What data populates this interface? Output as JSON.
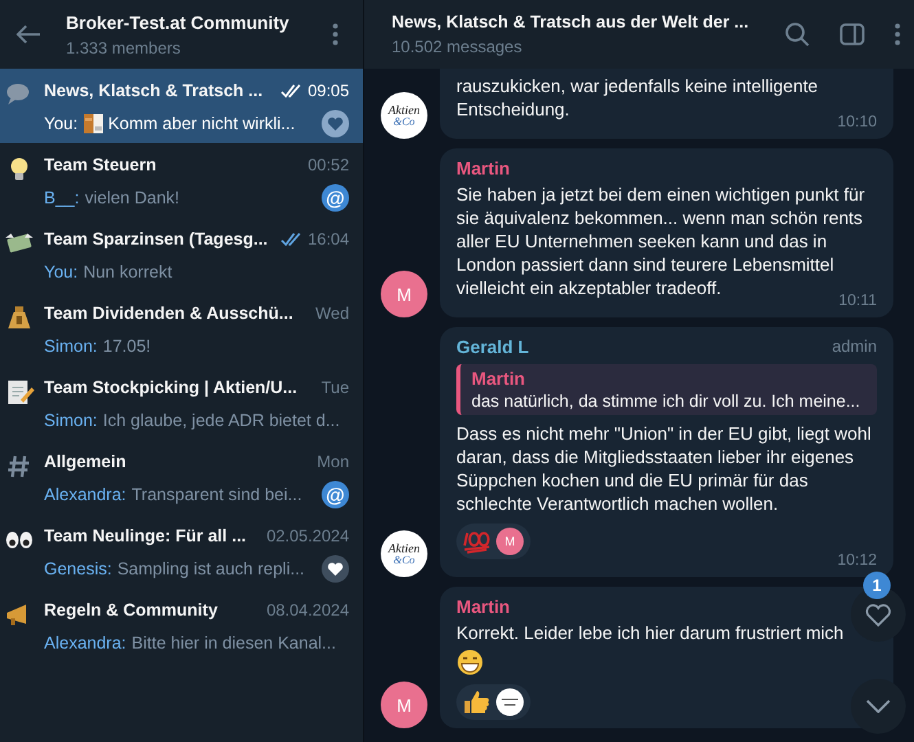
{
  "sidebar": {
    "back": true,
    "title": "Broker-Test.at Community",
    "subtitle": "1.333 members",
    "chats": [
      {
        "kind": "speech",
        "name": "News, Klatsch & Tratsch ...",
        "ticks": true,
        "time": "09:05",
        "sender": "You:",
        "thumbnail": true,
        "preview": "Komm aber nicht wirkli...",
        "badge": {
          "kind": "heart"
        },
        "selected": true
      },
      {
        "kind": "bulb",
        "name": "Team Steuern",
        "ticks": false,
        "time": "00:52",
        "sender": "B__:",
        "thumbnail": false,
        "preview": "vielen Dank!",
        "badge": {
          "kind": "mention",
          "text": "@"
        },
        "selected": false
      },
      {
        "kind": "money",
        "name": "Team Sparzinsen (Tagesg...",
        "ticks": true,
        "time": "16:04",
        "sender": "You:",
        "thumbnail": false,
        "preview": "Nun korrekt",
        "selected": false
      },
      {
        "kind": "bag",
        "name": "Team Dividenden & Ausschü...",
        "ticks": false,
        "time": "Wed",
        "sender": "Simon:",
        "thumbnail": false,
        "preview": "17.05!",
        "selected": false
      },
      {
        "kind": "memo",
        "name": "Team Stockpicking | Aktien/U...",
        "ticks": false,
        "time": "Tue",
        "sender": "Simon:",
        "thumbnail": false,
        "preview": "Ich glaube, jede ADR bietet d...",
        "selected": false
      },
      {
        "kind": "hash",
        "name": "Allgemein",
        "ticks": false,
        "time": "Mon",
        "sender": "Alexandra:",
        "thumbnail": false,
        "preview": "Transparent sind bei...",
        "badge": {
          "kind": "mention",
          "text": "@"
        },
        "selected": false
      },
      {
        "kind": "eyes",
        "name": "Team Neulinge: Für all ...",
        "ticks": false,
        "time": "02.05.2024",
        "sender": "Genesis:",
        "thumbnail": false,
        "preview": "Sampling ist auch repli...",
        "badge": {
          "kind": "heart"
        },
        "selected": false
      },
      {
        "kind": "megaphone",
        "name": "Regeln & Community",
        "ticks": false,
        "time": "08.04.2024",
        "sender": "Alexandra:",
        "thumbnail": false,
        "preview": "Bitte hier in diesen Kanal...",
        "selected": false
      }
    ]
  },
  "chat": {
    "title": "News, Klatsch & Tratsch aus der Welt der ...",
    "subtitle": "10.502 messages",
    "messages": [
      {
        "avatar": {
          "kind": "logo",
          "lines": [
            "Aktien",
            "&Co"
          ]
        },
        "text": "rauszukicken, war jedenfalls keine intelligente Entscheidung.",
        "time": "10:10"
      },
      {
        "sender": "Martin",
        "color": "#e9577f",
        "avatar": {
          "kind": "initial",
          "text": "M"
        },
        "text": "Sie haben ja jetzt bei dem einen wichtigen punkt für sie äquivalenz bekommen... wenn man schön rents aller EU Unternehmen seeken kann und das in London passiert dann sind teurere Lebensmittel vielleicht ein akzeptabler tradeoff.",
        "time": "10:11"
      },
      {
        "sender": "Gerald L",
        "color": "#64b5d9",
        "role": "admin",
        "avatar": {
          "kind": "logo",
          "lines": [
            "Aktien",
            "&Co"
          ]
        },
        "reply": {
          "sender": "Martin",
          "color": "#e9577f",
          "text": "das natürlich, da stimme ich dir voll zu. Ich meine..."
        },
        "text": "Dass es nicht mehr \"Union\" in der EU gibt, liegt wohl daran, dass die Mitgliedsstaaten lieber ihr eigenes Süppchen kochen und die EU primär für das schlechte Verantwortlich machen wollen.",
        "reactions": [
          {
            "kind": "hundred",
            "by": {
              "kind": "initial",
              "text": "M"
            }
          }
        ],
        "time": "10:12"
      },
      {
        "sender": "Martin",
        "color": "#e9577f",
        "avatar": {
          "kind": "initial",
          "text": "M"
        },
        "text": "Korrekt. Leider lebe ich hier darum frustriert mich",
        "emoji": true,
        "reactions": [
          {
            "kind": "thumbs",
            "by": {
              "kind": "logo"
            }
          }
        ]
      }
    ],
    "reaction_button": {
      "badge": "1"
    },
    "scroll_down": true
  }
}
